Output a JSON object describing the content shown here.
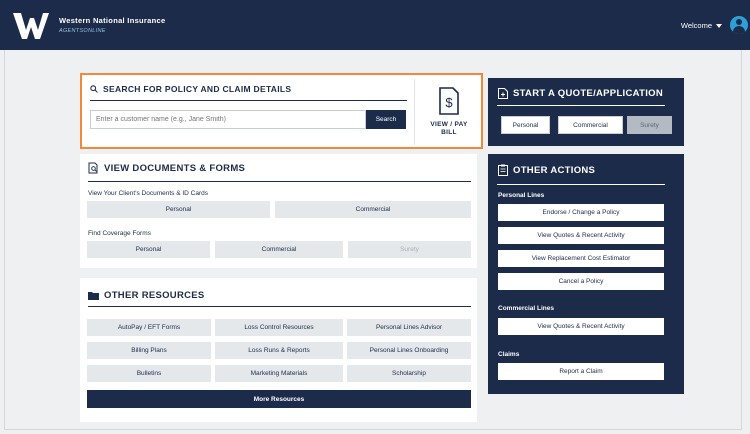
{
  "header": {
    "brand_title": "Western National Insurance",
    "brand_subtitle": "AGENTSONLINE",
    "welcome": "Welcome"
  },
  "search": {
    "title": "SEARCH FOR POLICY AND CLAIM DETAILS",
    "placeholder": "Enter a customer name (e.g., Jane Smith)",
    "button": "Search",
    "view_pay_bill": "VIEW / PAY BILL"
  },
  "documents": {
    "title": "VIEW DOCUMENTS & FORMS",
    "section1_label": "View Your Client's Documents & ID Cards",
    "section1_buttons": [
      "Personal",
      "Commercial"
    ],
    "section2_label": "Find Coverage Forms",
    "section2_buttons": [
      "Personal",
      "Commercial",
      "Surety"
    ]
  },
  "resources": {
    "title": "OTHER RESOURCES",
    "buttons": [
      "AutoPay / EFT Forms",
      "Loss Control Resources",
      "Personal Lines Advisor",
      "Billing Plans",
      "Loss Runs & Reports",
      "Personal Lines Onboarding",
      "Bulletins",
      "Marketing Materials",
      "Scholarship"
    ],
    "more": "More Resources"
  },
  "quote": {
    "title": "START A QUOTE/APPLICATION",
    "buttons": [
      "Personal",
      "Commercial",
      "Surety"
    ]
  },
  "actions": {
    "title": "OTHER ACTIONS",
    "personal_label": "Personal Lines",
    "personal": [
      "Endorse / Change a Policy",
      "View Quotes & Recent Activity",
      "View Replacement Cost Estimator",
      "Cancel a Policy"
    ],
    "commercial_label": "Commercial Lines",
    "commercial": [
      "View Quotes & Recent Activity"
    ],
    "claims_label": "Claims",
    "claims": [
      "Report a Claim"
    ]
  },
  "colors": {
    "navy": "#1c2b4a",
    "accent_orange": "#f0893a",
    "avatar_blue": "#2f9fd8",
    "button_gray": "#e5e8eb"
  }
}
